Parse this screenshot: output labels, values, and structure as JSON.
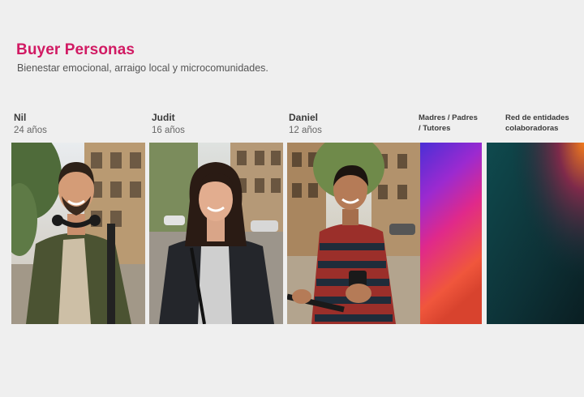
{
  "header": {
    "title": "Buyer Personas",
    "subtitle": "Bienestar emocional, arraigo local y microcomunidades."
  },
  "personas": [
    {
      "name": "Nil",
      "age": "24 años"
    },
    {
      "name": "Judit",
      "age": "16 años"
    },
    {
      "name": "Daniel",
      "age": "12 años"
    }
  ],
  "groups": [
    {
      "line1": "Madres / Padres",
      "line2": "/ Tutores"
    },
    {
      "line1": "Red de entidades",
      "line2": "colaboradoras"
    }
  ],
  "colors": {
    "accent": "#d11a63",
    "text_dark": "#3a3a3a",
    "text_muted": "#555555",
    "background": "#efefef"
  }
}
